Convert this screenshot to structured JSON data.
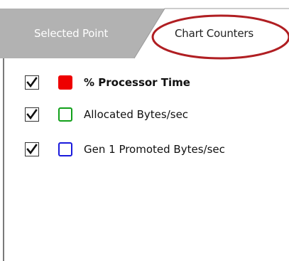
{
  "tabs": [
    {
      "label": "Selected Point",
      "active": false
    },
    {
      "label": "Chart Counters",
      "active": true,
      "highlighted": true
    }
  ],
  "counters": [
    {
      "label": "% Processor Time",
      "checked": true,
      "color": "#ee0000",
      "filled": true,
      "bold": true
    },
    {
      "label": "Allocated Bytes/sec",
      "checked": true,
      "color": "#11a01a",
      "filled": false,
      "bold": false
    },
    {
      "label": "Gen 1 Promoted Bytes/sec",
      "checked": true,
      "color": "#1a1adc",
      "filled": false,
      "bold": false
    }
  ],
  "colors": {
    "inactive_tab": "#b2b2b2",
    "highlight_ellipse": "#b01e22",
    "border": "#7a7a7a"
  }
}
